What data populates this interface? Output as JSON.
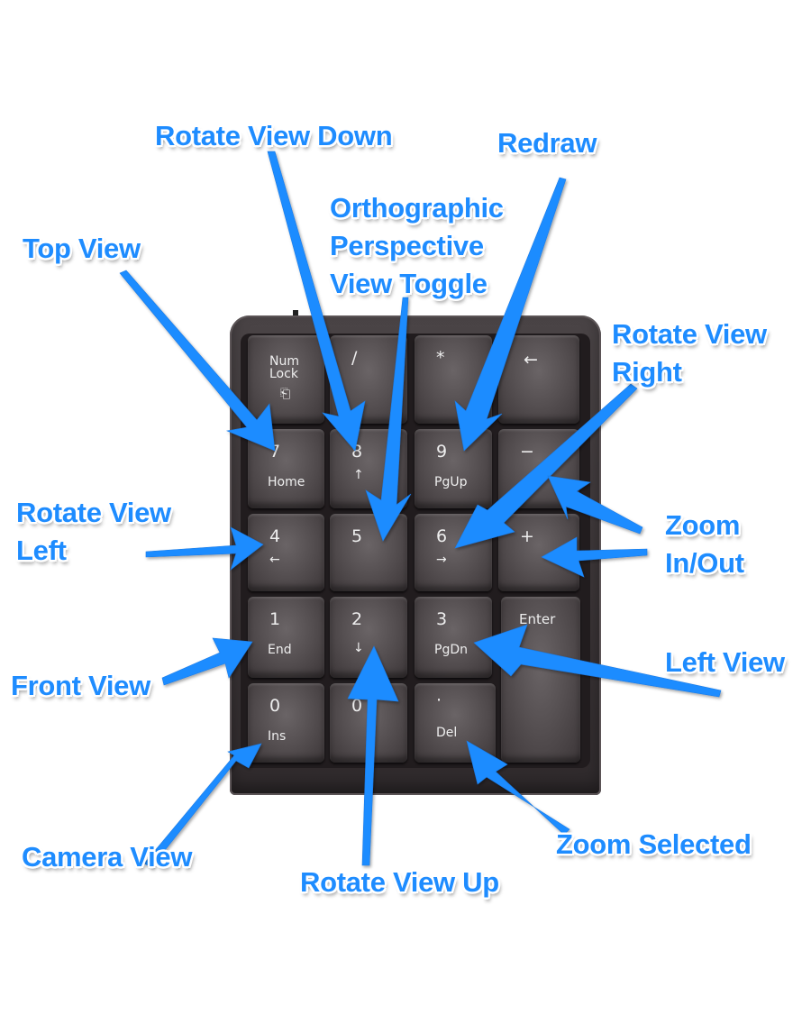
{
  "keypad": {
    "keys": [
      {
        "id": "numlock",
        "main": "Num\nLock",
        "sub": "⎗"
      },
      {
        "id": "divide",
        "main": "/",
        "sub": ""
      },
      {
        "id": "multiply",
        "main": "*",
        "sub": ""
      },
      {
        "id": "backspace",
        "main": "←",
        "sub": ""
      },
      {
        "id": "7",
        "main": "7",
        "sub": "Home"
      },
      {
        "id": "8",
        "main": "8",
        "sub": "↑"
      },
      {
        "id": "9",
        "main": "9",
        "sub": "PgUp"
      },
      {
        "id": "minus",
        "main": "−",
        "sub": ""
      },
      {
        "id": "4",
        "main": "4",
        "sub": "←"
      },
      {
        "id": "5",
        "main": "5",
        "sub": ""
      },
      {
        "id": "6",
        "main": "6",
        "sub": "→"
      },
      {
        "id": "plus",
        "main": "+",
        "sub": ""
      },
      {
        "id": "1",
        "main": "1",
        "sub": "End"
      },
      {
        "id": "2",
        "main": "2",
        "sub": "↓"
      },
      {
        "id": "3",
        "main": "3",
        "sub": "PgDn"
      },
      {
        "id": "enter",
        "main": "Enter",
        "sub": ""
      },
      {
        "id": "0-ins",
        "main": "0",
        "sub": "Ins"
      },
      {
        "id": "0",
        "main": "0",
        "sub": ""
      },
      {
        "id": "del",
        "main": "·",
        "sub": "Del"
      }
    ]
  },
  "labels": {
    "rotate_view_down": "Rotate View Down",
    "redraw": "Redraw",
    "ortho_line1": "Orthographic",
    "ortho_line2": "Perspective",
    "ortho_line3": "View Toggle",
    "top_view": "Top View",
    "rotate_view_right_line1": "Rotate View",
    "rotate_view_right_line2": "Right",
    "rotate_view_left_line1": "Rotate View",
    "rotate_view_left_line2": "Left",
    "zoom_inout_line1": "Zoom",
    "zoom_inout_line2": "In/Out",
    "left_view": "Left View",
    "front_view": "Front View",
    "camera_view": "Camera View",
    "rotate_view_up": "Rotate View Up",
    "zoom_selected": "Zoom Selected"
  },
  "colors": {
    "label": "#1e8cff",
    "arrow": "#1e8cff",
    "keypad": "#3a3436",
    "key_text": "#eeeeee"
  }
}
